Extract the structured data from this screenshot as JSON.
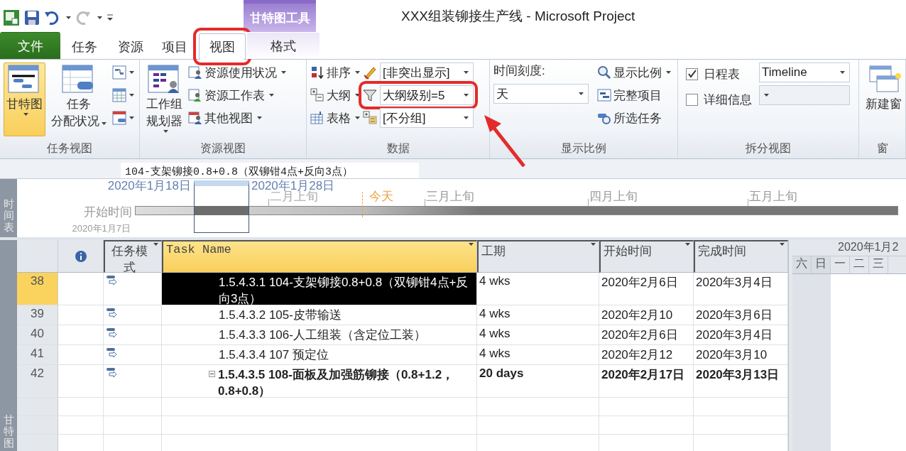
{
  "window": {
    "title": "XXX组装铆接生产线 - Microsoft Project"
  },
  "contextual_group": "甘特图工具",
  "tabs": [
    {
      "label": "文件",
      "kind": "file",
      "selected": false,
      "highlighted": false
    },
    {
      "label": "任务",
      "kind": "normal",
      "selected": false,
      "highlighted": false
    },
    {
      "label": "资源",
      "kind": "normal",
      "selected": false,
      "highlighted": false
    },
    {
      "label": "项目",
      "kind": "normal",
      "selected": false,
      "highlighted": false
    },
    {
      "label": "视图",
      "kind": "normal",
      "selected": true,
      "highlighted": true
    },
    {
      "label": "格式",
      "kind": "contextual",
      "selected": false,
      "highlighted": false
    }
  ],
  "ribbon_groups": [
    {
      "label": "任务视图",
      "columns": [
        [
          {
            "kind": "large",
            "lines": [
              "甘特图"
            ],
            "selected": true,
            "dropdown": true
          }
        ],
        [
          {
            "kind": "large",
            "lines": [
              "任务",
              "分配状况"
            ],
            "selected": false,
            "dropdown": true
          }
        ],
        [
          {
            "kind": "icon",
            "dropdown": true
          },
          {
            "kind": "icon",
            "dropdown": true
          },
          {
            "kind": "icon",
            "dropdown": true
          }
        ]
      ]
    },
    {
      "label": "资源视图",
      "columns": [
        [
          {
            "kind": "large",
            "lines": [
              "工作组",
              "规划器"
            ],
            "selected": false,
            "dropdown": true
          }
        ],
        [
          {
            "kind": "small",
            "label": "资源使用状况",
            "dropdown": true
          },
          {
            "kind": "small",
            "label": "资源工作表",
            "dropdown": true
          },
          {
            "kind": "small",
            "label": "其他视图",
            "dropdown": true
          }
        ]
      ]
    },
    {
      "label": "数据",
      "columns": [
        [
          {
            "kind": "small",
            "label": "排序",
            "dropdown": true
          },
          {
            "kind": "small",
            "label": "大纲",
            "dropdown": true
          },
          {
            "kind": "small",
            "label": "表格",
            "dropdown": true
          }
        ],
        [
          {
            "kind": "combo",
            "value": "[非突出显示]",
            "highlighted": false,
            "disabled": false
          },
          {
            "kind": "combo",
            "value": "大纲级别=5",
            "highlighted": true,
            "disabled": false
          },
          {
            "kind": "combo",
            "value": "[不分组]",
            "highlighted": false,
            "disabled": false
          }
        ]
      ]
    },
    {
      "label": "显示比例",
      "columns": [
        [
          {
            "kind": "text",
            "label": "时间刻度:"
          },
          {
            "kind": "combo",
            "value": "天",
            "highlighted": false,
            "disabled": false
          }
        ],
        [
          {
            "kind": "small",
            "label": "显示比例",
            "dropdown": true
          },
          {
            "kind": "small",
            "label": "完整项目",
            "dropdown": false
          },
          {
            "kind": "small",
            "label": "所选任务",
            "dropdown": false
          }
        ]
      ]
    },
    {
      "label": "拆分视图",
      "columns": [
        [
          {
            "kind": "checkbox",
            "label": "日程表",
            "checked": true
          },
          {
            "kind": "checkbox",
            "label": "详细信息",
            "checked": false
          }
        ],
        [
          {
            "kind": "combo",
            "value": "Timeline",
            "highlighted": false,
            "disabled": false
          },
          {
            "kind": "combo",
            "highlighted": false,
            "disabled": true
          }
        ]
      ]
    },
    {
      "label": "窗",
      "columns": [
        [
          {
            "kind": "large",
            "lines": [
              "新建窗"
            ],
            "selected": false,
            "dropdown": false
          }
        ]
      ]
    }
  ],
  "entry_bar": {
    "value": "104-支架铆接0.8+0.8（双铆钳4点+反向3点）"
  },
  "timeline": {
    "side_label": "时间表",
    "window_start": "2020年1月18日",
    "window_end": "2020年1月28日",
    "start_label": "开始时间",
    "start_date": "2020年1月7日",
    "ticks": [
      {
        "label": "二月上旬",
        "kind": "faded"
      },
      {
        "label": "今天",
        "kind": "today"
      },
      {
        "label": "三月上旬",
        "kind": "period"
      },
      {
        "label": "四月上旬",
        "kind": "period"
      },
      {
        "label": "五月上旬",
        "kind": "period"
      }
    ]
  },
  "side_label": "甘特图",
  "table": {
    "columns": [
      {
        "label": "任务模式",
        "selected": false
      },
      {
        "label": "Task Name",
        "selected": true
      },
      {
        "label": "工期",
        "selected": false
      },
      {
        "label": "开始时间",
        "selected": false
      },
      {
        "label": "完成时间",
        "selected": false
      }
    ],
    "rows": [
      {
        "id": "38",
        "name": "1.5.4.3.1 104-支架铆接0.8+0.8（双铆钳4点+反向3点）",
        "duration": "4 wks",
        "start": "2020年2月6日",
        "finish": "2020年3月4日",
        "summary": false,
        "selected": true
      },
      {
        "id": "39",
        "name": "1.5.4.3.2 105-皮带输送",
        "duration": "4 wks",
        "start": "2020年2月10",
        "finish": "2020年3月6日",
        "summary": false,
        "selected": false
      },
      {
        "id": "40",
        "name": "1.5.4.3.3 106-人工组装（含定位工装）",
        "duration": "4 wks",
        "start": "2020年2月6日",
        "finish": "2020年3月4日",
        "summary": false,
        "selected": false
      },
      {
        "id": "41",
        "name": "1.5.4.3.4 107 预定位",
        "duration": "4 wks",
        "start": "2020年2月12",
        "finish": "2020年3月10",
        "summary": false,
        "selected": false
      },
      {
        "id": "42",
        "name": "1.5.4.3.5 108-面板及加强筋铆接（0.8+1.2，0.8+0.8）",
        "duration": "20 days",
        "start": "2020年2月17日",
        "finish": "2020年3月13日",
        "summary": true,
        "selected": false
      }
    ]
  },
  "gantt": {
    "header": "2020年1月2",
    "days": [
      {
        "label": "六",
        "weekend": true
      },
      {
        "label": "日",
        "weekend": true
      },
      {
        "label": "一",
        "weekend": false
      },
      {
        "label": "二",
        "weekend": false
      },
      {
        "label": "三",
        "weekend": false
      }
    ]
  }
}
